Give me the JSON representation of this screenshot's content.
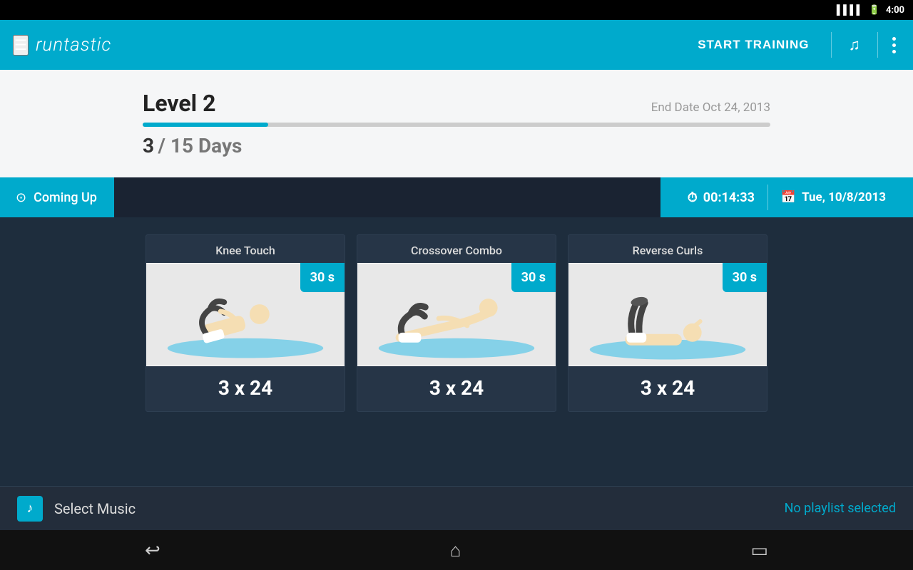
{
  "statusBar": {
    "time": "4:00",
    "signalIcon": "▌▌▌▌",
    "batteryIcon": "🔋"
  },
  "navbar": {
    "hamburgerIcon": "☰",
    "brandName": "runtastic",
    "startTrainingLabel": "START TRAINING",
    "musicIcon": "♫",
    "moreIcon": "⋮"
  },
  "levelSection": {
    "levelTitle": "Level 2",
    "endDateLabel": "End Date Oct 24, 2013",
    "progressPercent": 20,
    "currentDay": "3",
    "totalDays": "/ 15 Days"
  },
  "comingUp": {
    "label": "Coming Up",
    "clockIcon": "⏱",
    "timer": "00:14:33",
    "calendarIcon": "📅",
    "date": "Tue, 10/8/2013"
  },
  "exercises": [
    {
      "title": "Knee Touch",
      "duration": "30 s",
      "reps": "3 x 24"
    },
    {
      "title": "Crossover Combo",
      "duration": "30 s",
      "reps": "3 x 24"
    },
    {
      "title": "Reverse Curls",
      "duration": "30 s",
      "reps": "3 x 24"
    }
  ],
  "musicBar": {
    "selectMusicLabel": "Select Music",
    "noPlaylistLabel": "No playlist selected",
    "musicNoteIcon": "♪"
  },
  "bottomNav": {
    "backIcon": "↩",
    "homeIcon": "⌂",
    "recentIcon": "▭"
  }
}
